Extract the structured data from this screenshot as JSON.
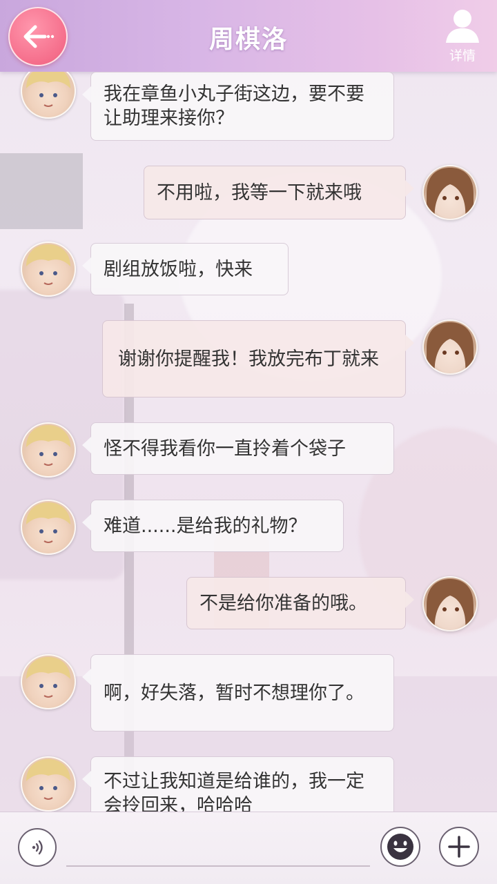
{
  "header": {
    "title": "周棋洛",
    "detail_label": "详情",
    "accent_color": "#f56e8b"
  },
  "messages": [
    {
      "side": "left",
      "text": "我在章鱼小丸子街这边，要不要让助理来接你？"
    },
    {
      "side": "right",
      "text": "不用啦，我等一下就来哦"
    },
    {
      "side": "left",
      "text": "剧组放饭啦，快来"
    },
    {
      "side": "right",
      "text": "谢谢你提醒我！我放完布丁就来"
    },
    {
      "side": "left",
      "text": "怪不得我看你一直拎着个袋子"
    },
    {
      "side": "left",
      "text": "难道......是给我的礼物？"
    },
    {
      "side": "right",
      "text": "不是给你准备的哦。"
    },
    {
      "side": "left",
      "text": "啊，好失落，暂时不想理你了。"
    },
    {
      "side": "left",
      "text": "不过让我知道是给谁的，我一定会拎回来，哈哈哈"
    }
  ],
  "input": {
    "voice_icon": "voice-icon",
    "emoji_icon": "emoji-icon",
    "plus_icon": "plus-icon"
  }
}
